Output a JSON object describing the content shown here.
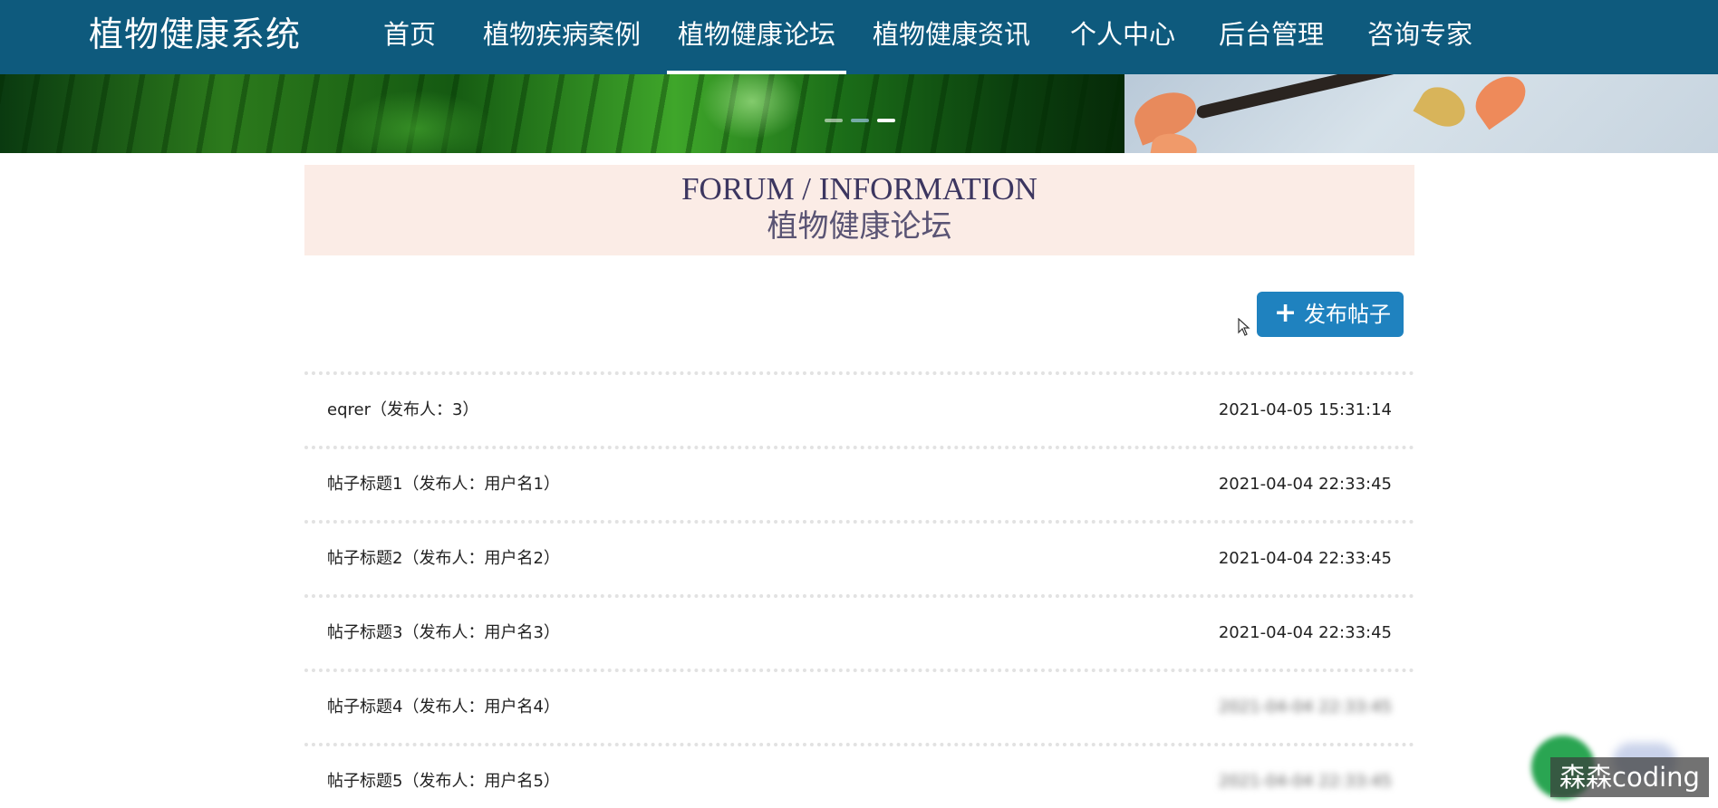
{
  "app": {
    "title": "植物健康系统"
  },
  "nav": {
    "items": [
      {
        "label": "首页"
      },
      {
        "label": "植物疾病案例"
      },
      {
        "label": "植物健康论坛",
        "active": true
      },
      {
        "label": "植物健康资讯"
      },
      {
        "label": "个人中心"
      },
      {
        "label": "后台管理"
      },
      {
        "label": "咨询专家"
      }
    ]
  },
  "banner": {
    "slides_total": 3,
    "active_slide": 3
  },
  "section": {
    "title_en": "FORUM / INFORMATION",
    "title_cn": "植物健康论坛"
  },
  "actions": {
    "post_icon": "+",
    "post_label": "发布帖子"
  },
  "posts": [
    {
      "title": "eqrer（发布人：3）",
      "date": "2021-04-05 15:31:14"
    },
    {
      "title": "帖子标题1（发布人：用户名1）",
      "date": "2021-04-04 22:33:45"
    },
    {
      "title": "帖子标题2（发布人：用户名2）",
      "date": "2021-04-04 22:33:45"
    },
    {
      "title": "帖子标题3（发布人：用户名3）",
      "date": "2021-04-04 22:33:45"
    },
    {
      "title": "帖子标题4（发布人：用户名4）",
      "date": "2021-04-04 22:33:45"
    },
    {
      "title": "帖子标题5（发布人：用户名5）",
      "date": "2021-04-04 22:33:45"
    }
  ],
  "watermark": {
    "text": "森森coding"
  },
  "colors": {
    "header_bg": "#0e5a7d",
    "accent_button": "#1f82bf",
    "title_box_bg": "#fbece6",
    "title_text": "#3c3660"
  }
}
